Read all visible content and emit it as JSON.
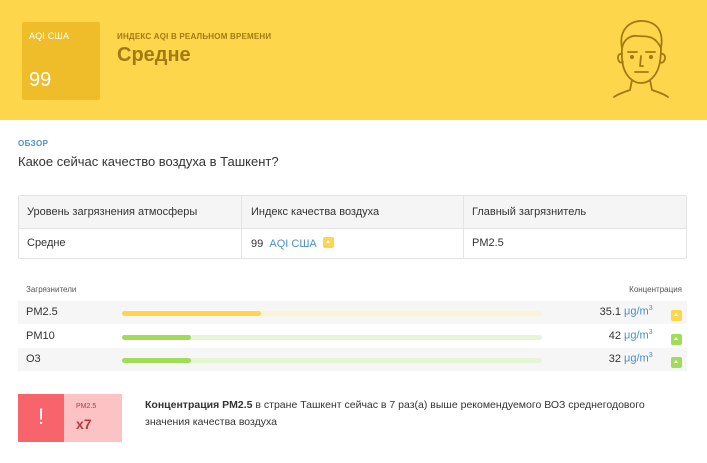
{
  "header": {
    "aqi_label": "AQI США",
    "aqi_value": "99",
    "subtitle": "ИНДЕКС AQI В РЕАЛЬНОМ ВРЕМЕНИ",
    "title": "Средне",
    "face_icon": "moderate-face-icon",
    "bg_color": "#fdd64b",
    "badge_color": "#efbd29"
  },
  "overview": {
    "label": "ОБЗОР",
    "question": "Какое сейчас качество воздуха в Ташкент?"
  },
  "info_table": {
    "headers": [
      "Уровень загрязнения атмосферы",
      "Индекс качества воздуха",
      "Главный загрязнитель"
    ],
    "level": "Средне",
    "aqi_value": "99",
    "aqi_unit": "AQI США",
    "main_pollutant": "PM2.5"
  },
  "pollutants": {
    "header_left": "Загрязнители",
    "header_right": "Концентрация",
    "unit": "μg/m",
    "unit_sup": "3",
    "rows": [
      {
        "name": "PM2.5",
        "value": "35.1",
        "fill_fraction": 0.33,
        "bar_color": "#fdd64b",
        "track_color": "#fdf5d2",
        "indicator_color": "#fdd64b"
      },
      {
        "name": "PM10",
        "value": "42",
        "fill_fraction": 0.165,
        "bar_color": "#9fdc57",
        "track_color": "#e6f5d5",
        "indicator_color": "#9fdc57"
      },
      {
        "name": "O3",
        "value": "32",
        "fill_fraction": 0.165,
        "bar_color": "#9fdc57",
        "track_color": "#e6f5d5",
        "indicator_color": "#9fdc57"
      }
    ]
  },
  "alert": {
    "icon": "!",
    "pm_label": "PM2.5",
    "multiplier": "x7",
    "bold_text": "Концентрация PM2.5",
    "text": " в стране Ташкент сейчас в 7 раз(а) выше рекомендуемого ВОЗ среднегодового значения качества воздуха"
  }
}
